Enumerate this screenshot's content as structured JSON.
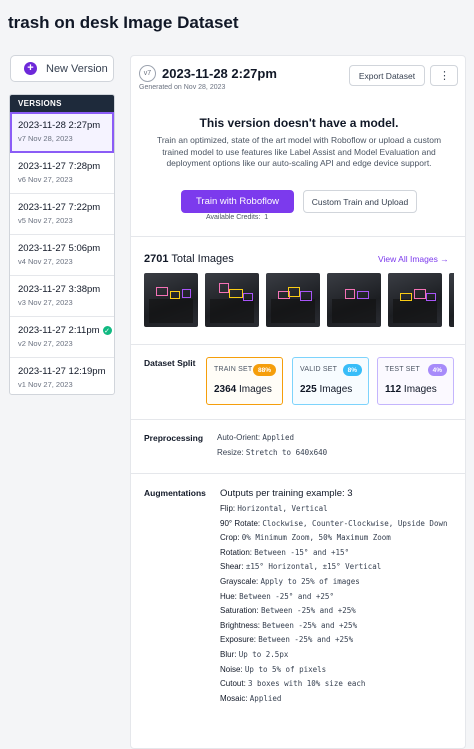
{
  "page": {
    "title": "trash on desk Image Dataset"
  },
  "sidebar": {
    "new_version_label": "New Version",
    "versions_header": "VERSIONS",
    "items": [
      {
        "date": "2023-11-28 2:27pm",
        "sub": "v7 Nov 28, 2023",
        "active": true
      },
      {
        "date": "2023-11-27 7:28pm",
        "sub": "v6 Nov 27, 2023"
      },
      {
        "date": "2023-11-27 7:22pm",
        "sub": "v5 Nov 27, 2023"
      },
      {
        "date": "2023-11-27 5:06pm",
        "sub": "v4 Nov 27, 2023"
      },
      {
        "date": "2023-11-27 3:38pm",
        "sub": "v3 Nov 27, 2023"
      },
      {
        "date": "2023-11-27 2:11pm",
        "sub": "v2 Nov 27, 2023",
        "check": true
      },
      {
        "date": "2023-11-27 12:19pm",
        "sub": "v1 Nov 27, 2023"
      }
    ]
  },
  "version": {
    "badge": "v7",
    "title": "2023-11-28 2:27pm",
    "generated": "Generated on Nov 28, 2023",
    "export_label": "Export Dataset",
    "more_label": "⋮"
  },
  "model": {
    "title": "This version doesn't have a model.",
    "text": "Train an optimized, state of the art model with Roboflow or upload a custom trained model to use features like Label Assist and Model Evaluation and deployment options like our auto-scaling API and edge device support.",
    "train_label": "Train with Roboflow",
    "custom_label": "Custom Train and Upload",
    "credits_label": "Available Credits:",
    "credits_value": "1"
  },
  "images": {
    "count": "2701",
    "label": "Total Images",
    "view_all": "View All Images →"
  },
  "split": {
    "label": "Dataset Split",
    "train": {
      "name": "TRAIN SET",
      "pct": "88%",
      "count": "2364",
      "unit": "Images",
      "color": "#f59e0b"
    },
    "valid": {
      "name": "VALID SET",
      "pct": "8%",
      "count": "225",
      "unit": "Images",
      "color": "#38bdf8"
    },
    "test": {
      "name": "TEST SET",
      "pct": "4%",
      "count": "112",
      "unit": "Images",
      "color": "#a78bfa"
    }
  },
  "preprocessing": {
    "label": "Preprocessing",
    "items": [
      {
        "k": "Auto-Orient:",
        "v": "Applied"
      },
      {
        "k": "Resize:",
        "v": "Stretch to 640x640"
      }
    ]
  },
  "augmentations": {
    "label": "Augmentations",
    "head": "Outputs per training example: 3",
    "items": [
      {
        "k": "Flip:",
        "v": "Horizontal, Vertical"
      },
      {
        "k": "90° Rotate:",
        "v": "Clockwise, Counter-Clockwise, Upside Down"
      },
      {
        "k": "Crop:",
        "v": "0% Minimum Zoom, 50% Maximum Zoom"
      },
      {
        "k": "Rotation:",
        "v": "Between -15° and +15°"
      },
      {
        "k": "Shear:",
        "v": "±15° Horizontal, ±15° Vertical"
      },
      {
        "k": "Grayscale:",
        "v": "Apply to 25% of images"
      },
      {
        "k": "Hue:",
        "v": "Between -25° and +25°"
      },
      {
        "k": "Saturation:",
        "v": "Between -25% and +25%"
      },
      {
        "k": "Brightness:",
        "v": "Between -25% and +25%"
      },
      {
        "k": "Exposure:",
        "v": "Between -25% and +25%"
      },
      {
        "k": "Blur:",
        "v": "Up to 2.5px"
      },
      {
        "k": "Noise:",
        "v": "Up to 5% of pixels"
      },
      {
        "k": "Cutout:",
        "v": "3 boxes with 10% size each"
      },
      {
        "k": "Mosaic:",
        "v": "Applied"
      }
    ]
  },
  "colors": {
    "accent": "#7c3aed",
    "sidebar_header": "#1e2a3b",
    "success": "#10b981"
  }
}
